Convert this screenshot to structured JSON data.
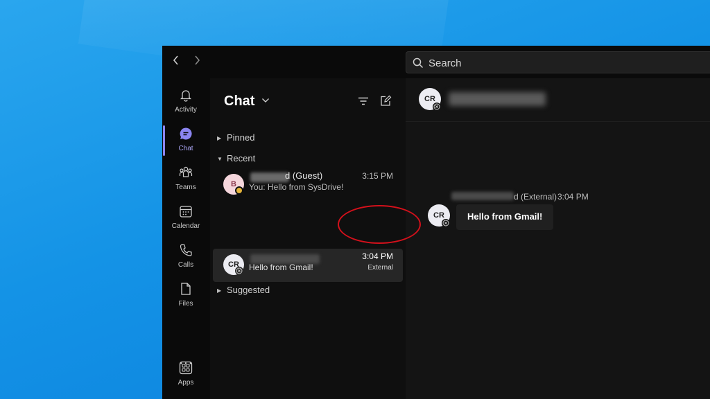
{
  "topbar": {
    "back_icon": "chevron-left-icon",
    "forward_icon": "chevron-right-icon",
    "search_placeholder": "Search"
  },
  "rail": {
    "items": [
      {
        "label": "Activity",
        "icon": "bell-icon"
      },
      {
        "label": "Chat",
        "icon": "chat-icon",
        "active": true
      },
      {
        "label": "Teams",
        "icon": "teams-icon"
      },
      {
        "label": "Calendar",
        "icon": "calendar-icon"
      },
      {
        "label": "Calls",
        "icon": "phone-icon"
      },
      {
        "label": "Files",
        "icon": "file-icon"
      },
      {
        "label": "Apps",
        "icon": "apps-icon"
      }
    ],
    "more_label": "···"
  },
  "chat_list": {
    "title": "Chat",
    "sections": {
      "pinned": "Pinned",
      "recent": "Recent",
      "suggested": "Suggested"
    },
    "chats": [
      {
        "avatar": "B",
        "name_suffix": "d (Guest)",
        "preview": "You: Hello from SysDrive!",
        "time": "3:15 PM",
        "badge": ""
      },
      {
        "avatar": "CR",
        "name_suffix": "",
        "preview": "Hello from Gmail!",
        "time": "3:04 PM",
        "badge": "External"
      }
    ]
  },
  "conversation": {
    "header_avatar": "CR",
    "message": {
      "avatar": "CR",
      "sender_suffix": "d (External)",
      "time": "3:04 PM",
      "text": "Hello from Gmail!"
    }
  },
  "colors": {
    "accent": "#8b85f0",
    "annotation": "#d4101b",
    "guest_status": "#e6b53a"
  }
}
